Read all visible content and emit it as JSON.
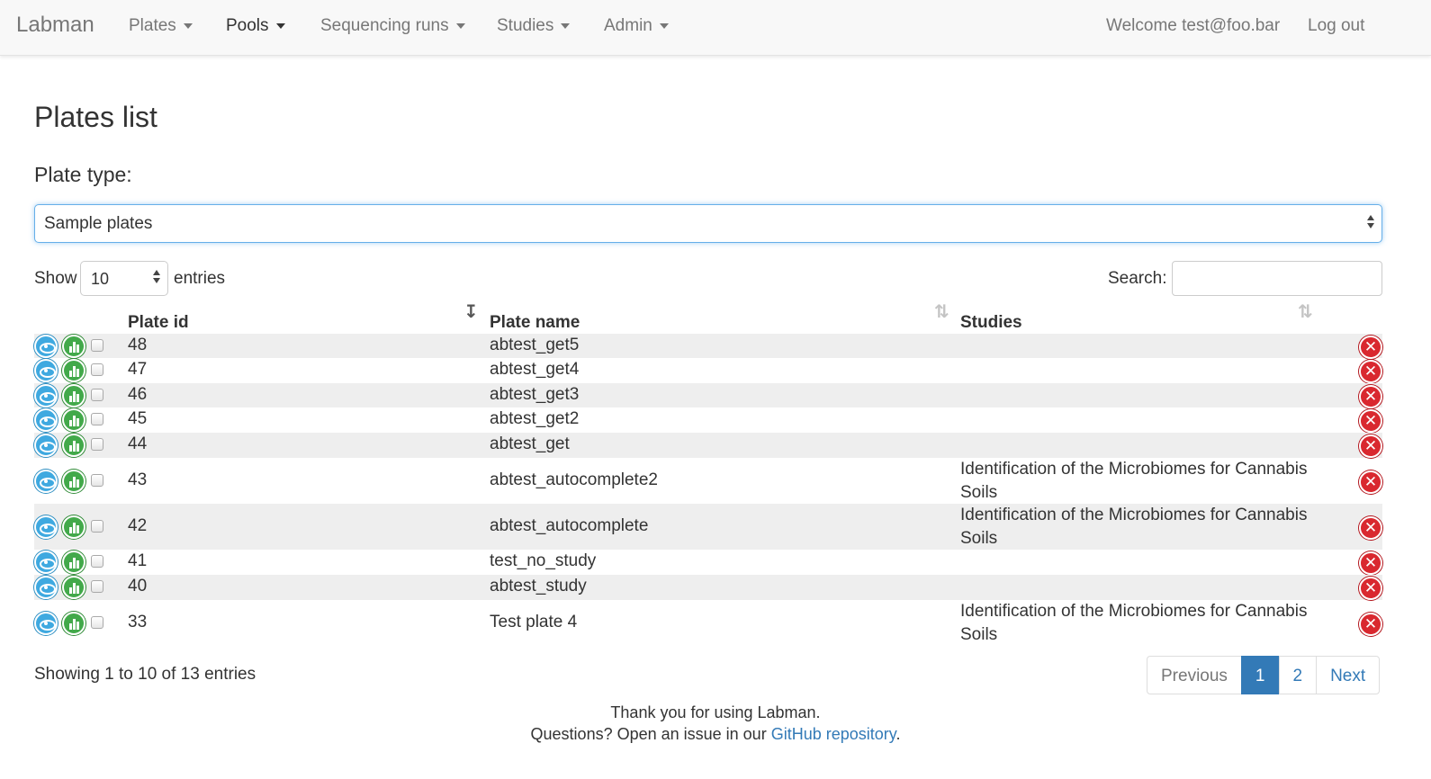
{
  "navbar": {
    "brand": "Labman",
    "menus": [
      {
        "label": "Plates"
      },
      {
        "label": "Pools"
      },
      {
        "label": "Sequencing runs"
      },
      {
        "label": "Studies"
      },
      {
        "label": "Admin"
      }
    ],
    "welcome": "Welcome test@foo.bar",
    "logout": "Log out"
  },
  "page": {
    "title": "Plates list",
    "plate_type_label": "Plate type:",
    "plate_type_selected": "Sample plates"
  },
  "table_controls": {
    "show_label": "Show",
    "page_length": "10",
    "entries_label": "entries",
    "search_label": "Search:",
    "search_value": ""
  },
  "table": {
    "columns": [
      "Plate id",
      "Plate name",
      "Studies"
    ],
    "rows": [
      {
        "id": "48",
        "name": "abtest_get5",
        "studies": ""
      },
      {
        "id": "47",
        "name": "abtest_get4",
        "studies": ""
      },
      {
        "id": "46",
        "name": "abtest_get3",
        "studies": ""
      },
      {
        "id": "45",
        "name": "abtest_get2",
        "studies": ""
      },
      {
        "id": "44",
        "name": "abtest_get",
        "studies": ""
      },
      {
        "id": "43",
        "name": "abtest_autocomplete2",
        "studies": "Identification of the Microbiomes for Cannabis Soils"
      },
      {
        "id": "42",
        "name": "abtest_autocomplete",
        "studies": "Identification of the Microbiomes for Cannabis Soils"
      },
      {
        "id": "41",
        "name": "test_no_study",
        "studies": ""
      },
      {
        "id": "40",
        "name": "abtest_study",
        "studies": ""
      },
      {
        "id": "33",
        "name": "Test plate 4",
        "studies": "Identification of the Microbiomes for Cannabis Soils"
      }
    ],
    "row_icons": [
      "eye-icon",
      "chart-icon",
      "checkbox",
      "delete-icon"
    ]
  },
  "pagination": {
    "info": "Showing 1 to 10 of 13 entries",
    "previous": "Previous",
    "pages": [
      "1",
      "2"
    ],
    "current": "1",
    "next": "Next"
  },
  "footer": {
    "line1": "Thank you for using Labman.",
    "line2_prefix": "Questions? Open an issue in our",
    "link_text": "GitHub repository",
    "line2_suffix": "."
  },
  "colors": {
    "accent": "#337ab7",
    "eye": "#3fa9e0",
    "chart": "#42a94a",
    "delete": "#d9282f",
    "stripe": "#eeeeee"
  }
}
